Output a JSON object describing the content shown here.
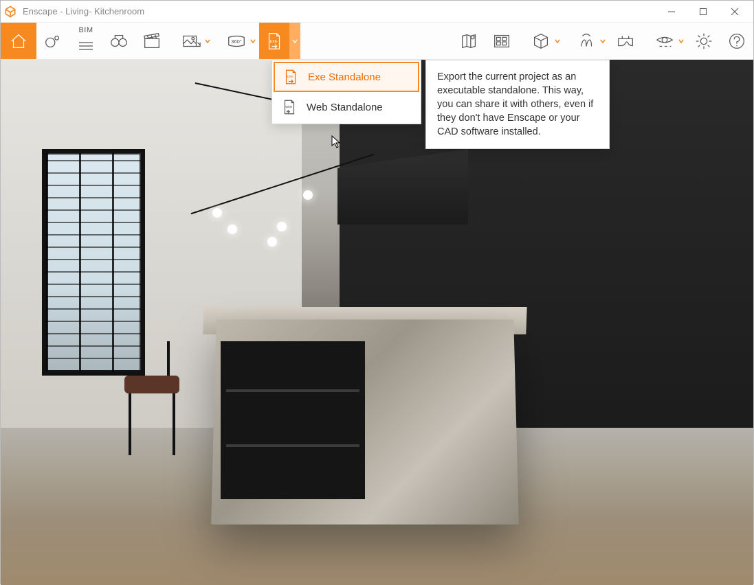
{
  "window": {
    "title": "Enscape - Living- Kitchenroom"
  },
  "toolbar": {
    "bim_label": "BIM",
    "panorama_label": "360°"
  },
  "export_menu": {
    "items": [
      {
        "label": "Exe Standalone",
        "icon": "exe-export-icon",
        "selected": true
      },
      {
        "label": "Web Standalone",
        "icon": "web-export-icon",
        "selected": false
      }
    ]
  },
  "tooltip": {
    "text": "Export the current project as an executable standalone. This way, you can share it with others, even if they don't have Enscape or your CAD software installed."
  }
}
